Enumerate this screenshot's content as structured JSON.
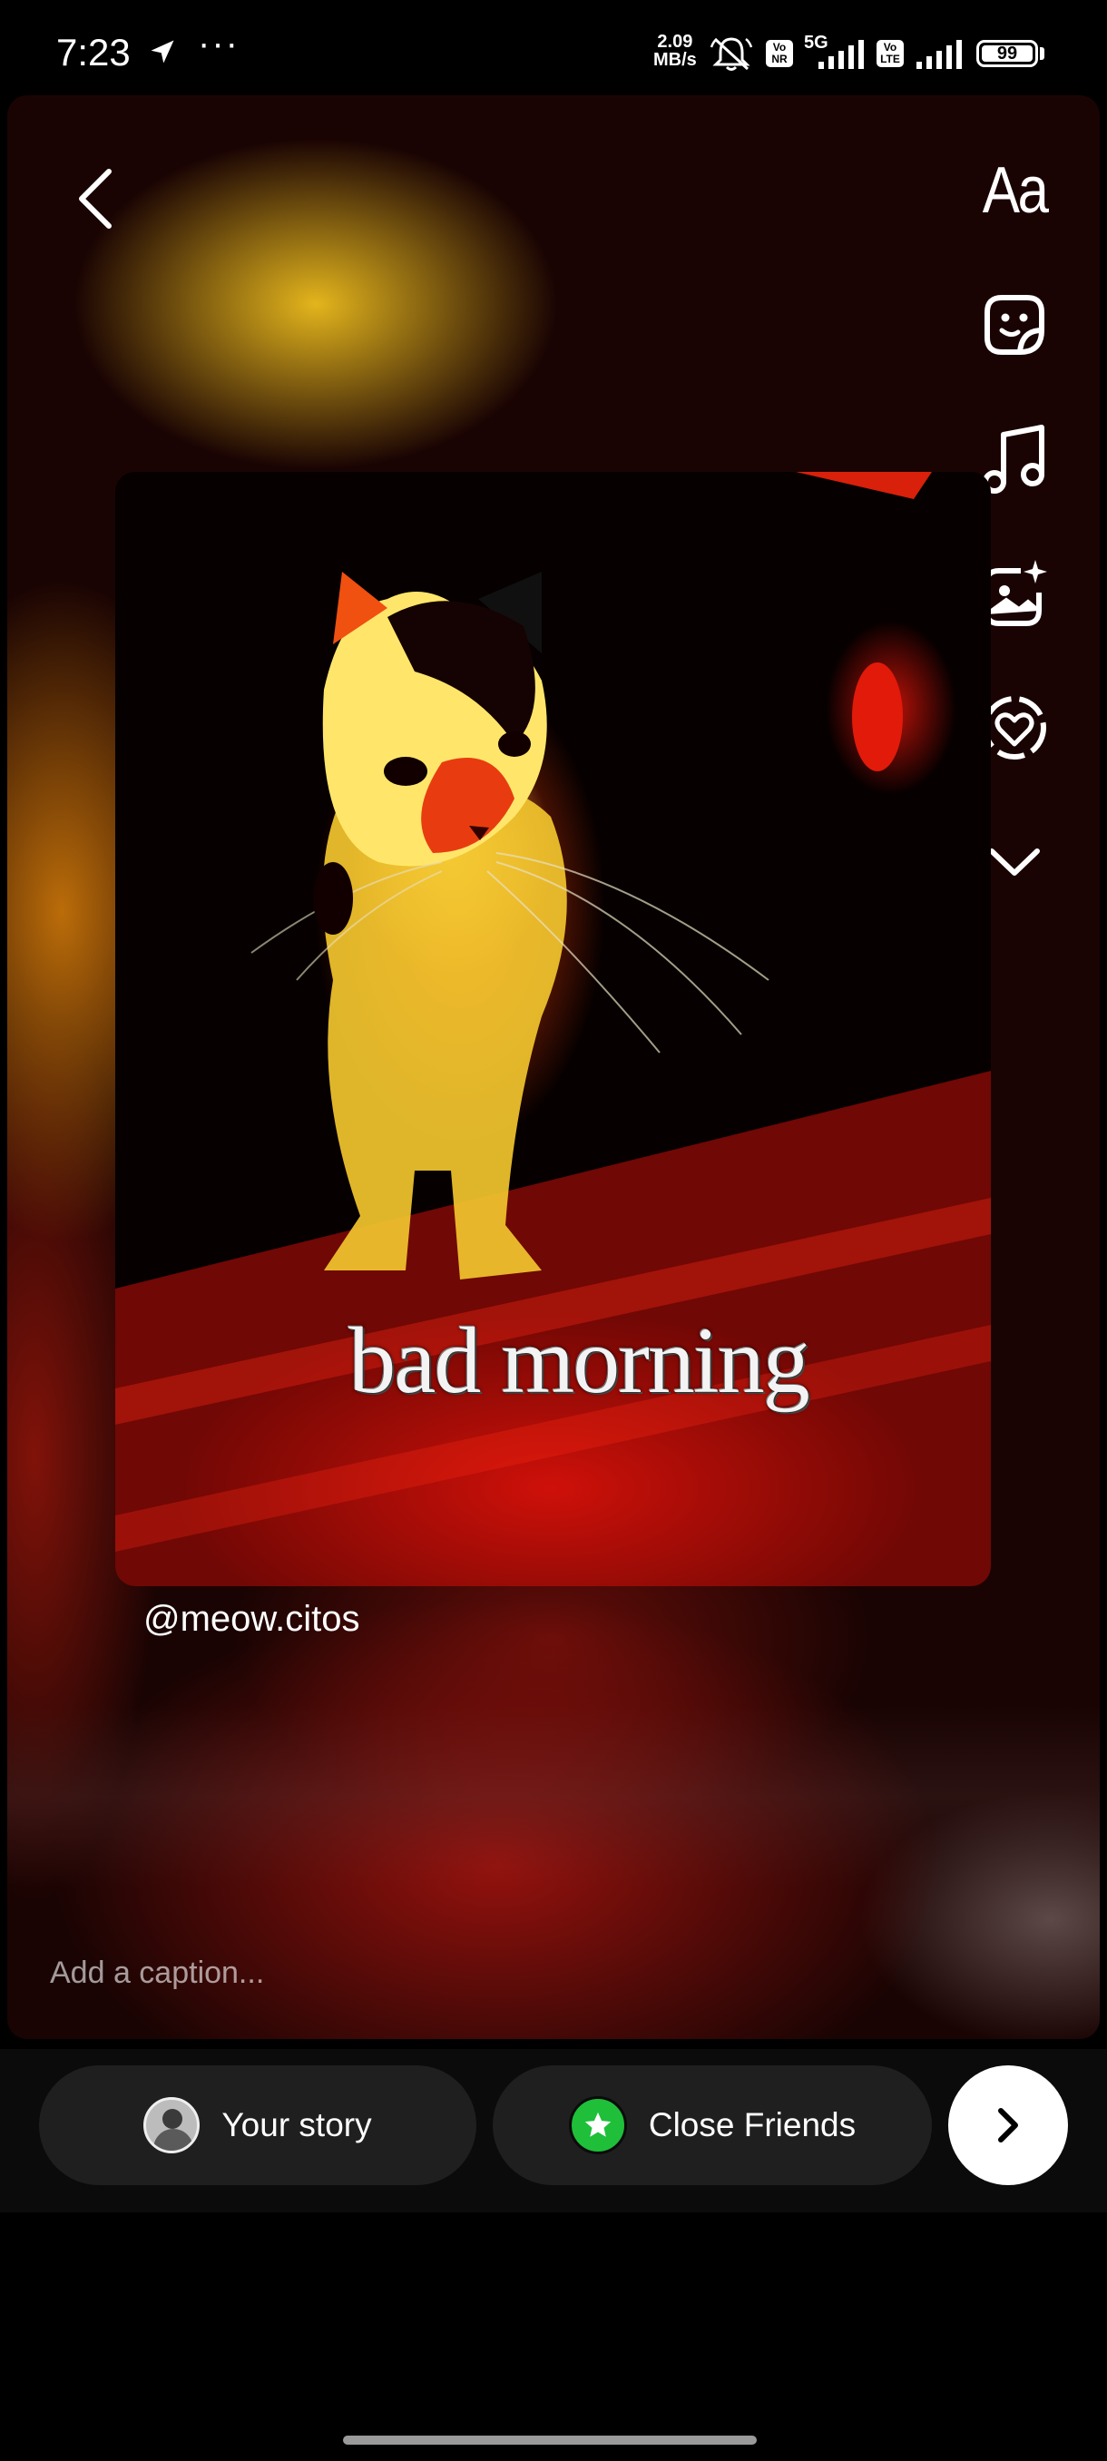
{
  "status_bar": {
    "time": "7:23",
    "dots": "···",
    "net_speed_value": "2.09",
    "net_speed_unit": "MB/s",
    "sim1_badge": "Vo NR",
    "network_type": "5G",
    "sim2_badge": "Vo LTE",
    "battery": "99"
  },
  "toolbar": {
    "text_tool_label": "Aa",
    "icons": [
      "back-icon",
      "sticker-icon",
      "music-icon",
      "effects-icon",
      "mention-heart-icon",
      "chevron-down-icon"
    ]
  },
  "post": {
    "overlay_text": "bad morning",
    "mention": "@meow.citos"
  },
  "caption": {
    "placeholder": "Add a caption..."
  },
  "share": {
    "your_story_label": "Your story",
    "close_friends_label": "Close Friends"
  },
  "colors": {
    "close_friends_green": "#1fbf3a",
    "pill_bg": "#1f1f1f",
    "share_bar_bg": "#0b0b0b"
  }
}
